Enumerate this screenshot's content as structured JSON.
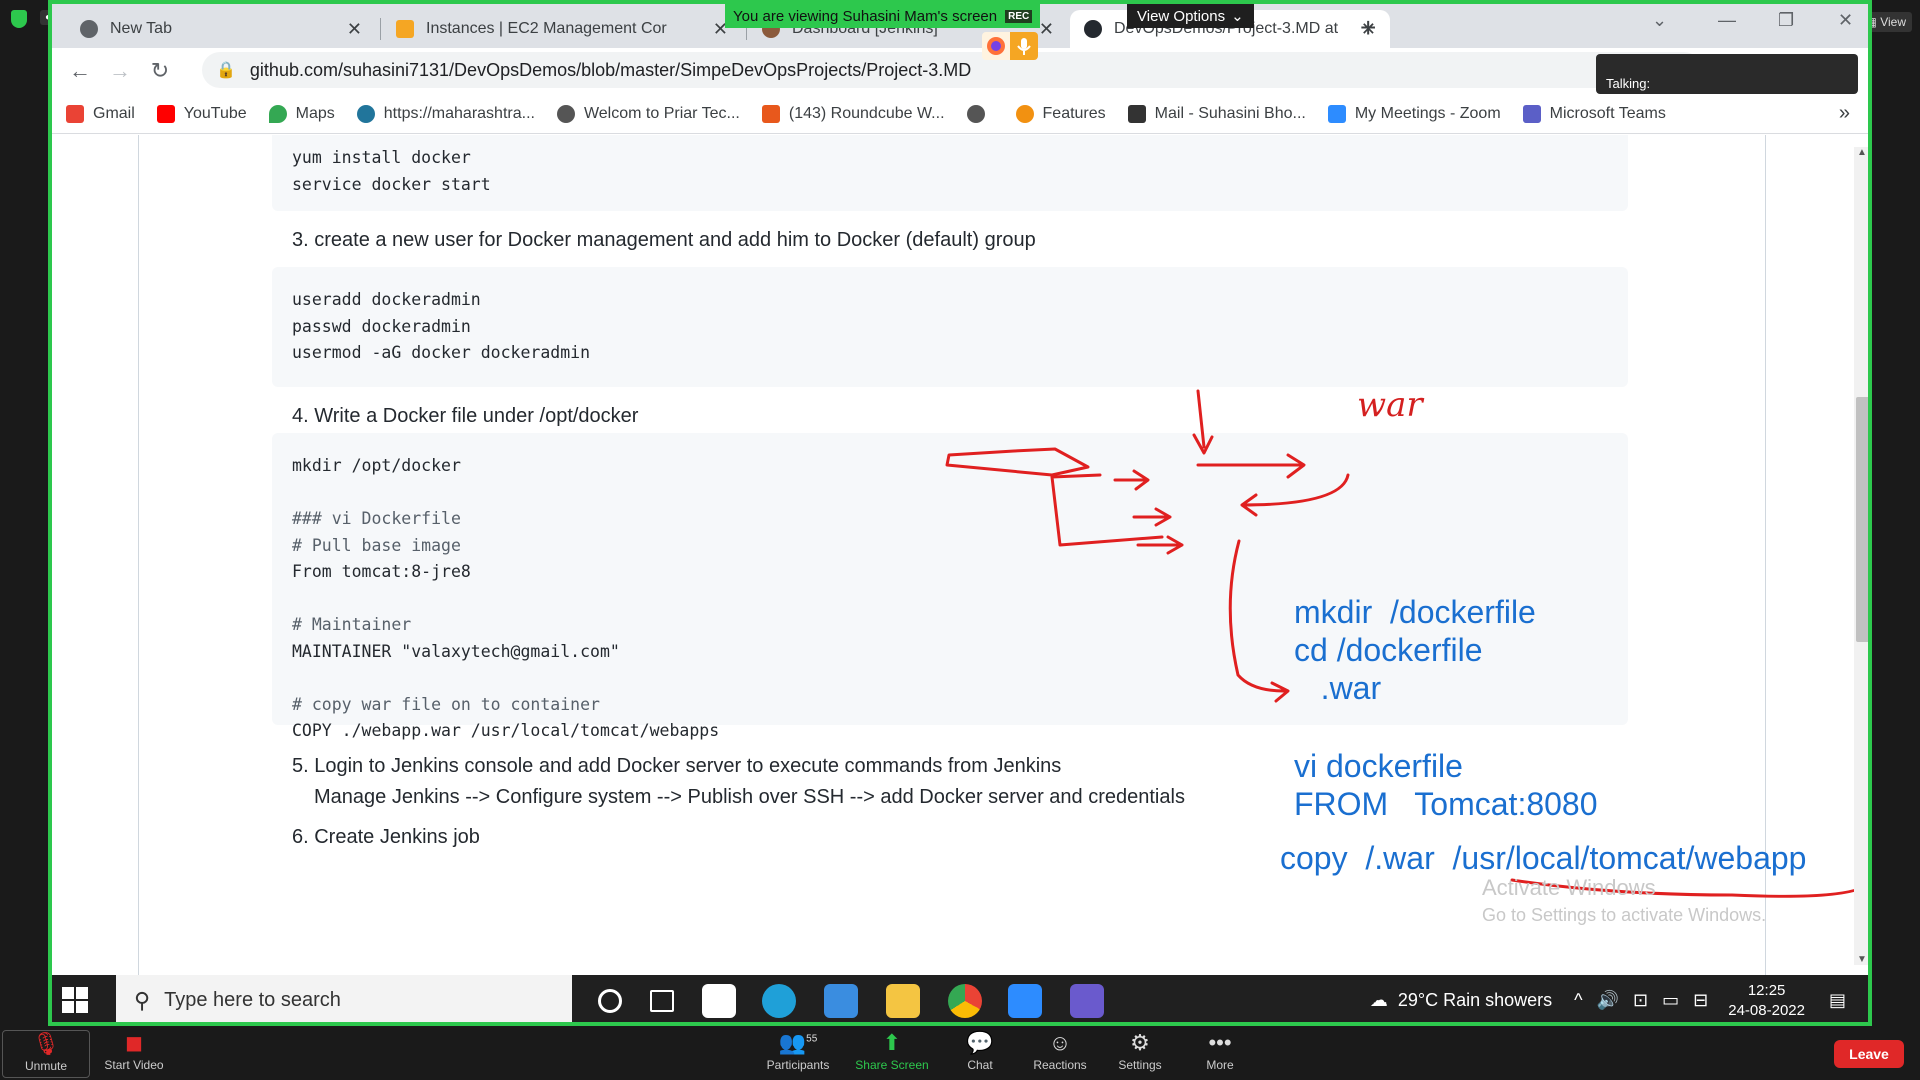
{
  "zoom": {
    "viewing_banner": "You are viewing Suhasini Mam's screen",
    "rec_label": "REC",
    "view_options": "View Options",
    "talking_label": "Talking:",
    "view_label": "View",
    "controls": {
      "unmute": "Unmute",
      "start_video": "Start Video",
      "participants": "Participants",
      "participants_count": "55",
      "share_screen": "Share Screen",
      "chat": "Chat",
      "reactions": "Reactions",
      "settings": "Settings",
      "more": "More",
      "leave": "Leave"
    }
  },
  "browser": {
    "tabs": [
      {
        "title": "New Tab",
        "icon": "chrome-icon"
      },
      {
        "title": "Instances | EC2 Management Cor",
        "icon": "aws-icon"
      },
      {
        "title": "Dashboard [Jenkins]",
        "icon": "jenkins-icon"
      },
      {
        "title": "DevOpsDemos/Project-3.MD at",
        "icon": "github-icon"
      }
    ],
    "url": "github.com/suhasini7131/DevOpsDemos/blob/master/SimpeDevOpsProjects/Project-3.MD",
    "bookmarks": [
      {
        "label": "Gmail",
        "color": "#ea4335"
      },
      {
        "label": "YouTube",
        "color": "#ff0000"
      },
      {
        "label": "Maps",
        "color": "#34a853"
      },
      {
        "label": "https://maharashtra...",
        "color": "#21759b"
      },
      {
        "label": "Welcom to Priar Tec...",
        "color": "#555555"
      },
      {
        "label": "(143) Roundcube W...",
        "color": "#e8581c"
      },
      {
        "label": "",
        "color": "#555555"
      },
      {
        "label": "Features",
        "color": "#f29111"
      },
      {
        "label": "Mail - Suhasini Bho...",
        "color": "#333333"
      },
      {
        "label": "My Meetings - Zoom",
        "color": "#2d8cff"
      },
      {
        "label": "Microsoft Teams",
        "color": "#5b5fc7"
      }
    ]
  },
  "document": {
    "code1": [
      "yum install docker",
      "service docker start"
    ],
    "step3": "3. create a new user for Docker management and add him to Docker (default) group",
    "code2": [
      "useradd dockeradmin",
      "passwd dockeradmin",
      "usermod -aG docker dockeradmin"
    ],
    "step4": "4. Write a Docker file under /opt/docker",
    "code3": [
      "mkdir /opt/docker",
      "",
      "### vi Dockerfile",
      "# Pull base image",
      "From tomcat:8-jre8",
      "",
      "# Maintainer",
      "MAINTAINER \"valaxytech@gmail.com\"",
      "",
      "# copy war file on to container",
      "COPY ./webapp.war /usr/local/tomcat/webapps"
    ],
    "step5": "5. Login to Jenkins console and add Docker server to execute commands from Jenkins",
    "step5_sub": "Manage Jenkins --> Configure system --> Publish over SSH --> add Docker server and credentials",
    "step6": "6. Create Jenkins job"
  },
  "annotations": {
    "war_label": "war",
    "blue_block1": "mkdir  /dockerfile\ncd /dockerfile\n   .war",
    "blue_block2": "vi dockerfile\nFROM   Tomcat:8080",
    "blue_line": "copy  /.war  /usr/local/tomcat/webapp"
  },
  "watermark": {
    "title": "Activate Windows",
    "subtitle": "Go to Settings to activate Windows."
  },
  "taskbar": {
    "search_placeholder": "Type here to search",
    "weather": "29°C  Rain showers",
    "time": "12:25",
    "date": "24-08-2022"
  }
}
